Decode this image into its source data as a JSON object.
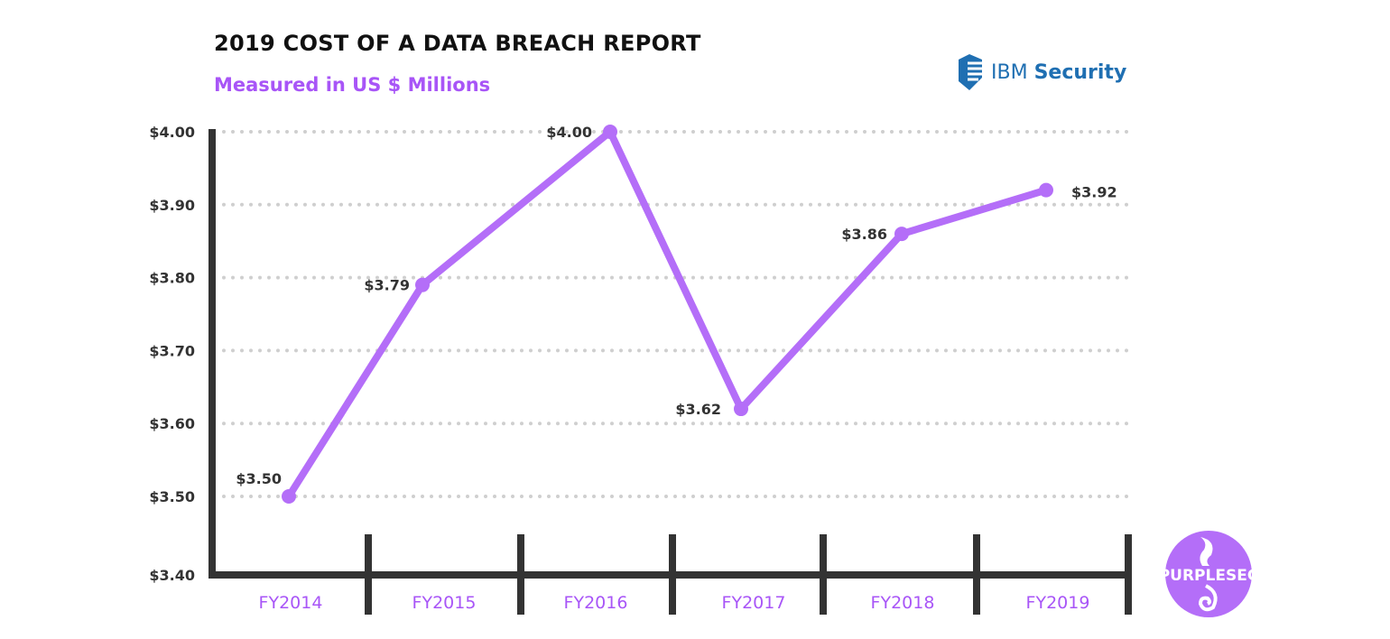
{
  "header": {
    "title": "2019 COST OF A DATA BREACH REPORT",
    "subtitle": "Measured in US $ Millions"
  },
  "logos": {
    "ibm": {
      "prefix": "IBM",
      "name": "Security",
      "color": "#1f6fb2"
    },
    "purplesec": {
      "text": "PURPLESEC",
      "color": "#b46ef8"
    }
  },
  "chart_data": {
    "type": "line",
    "title": "2019 COST OF A DATA BREACH REPORT",
    "subtitle": "Measured in US $ Millions",
    "categories": [
      "FY2014",
      "FY2015",
      "FY2016",
      "FY2017",
      "FY2018",
      "FY2019"
    ],
    "values": [
      3.5,
      3.79,
      4.0,
      3.62,
      3.86,
      3.92
    ],
    "data_labels": [
      "$3.50",
      "$3.79",
      "$4.00",
      "$3.62",
      "$3.86",
      "$3.92"
    ],
    "y_ticks": [
      3.4,
      3.5,
      3.6,
      3.7,
      3.8,
      3.9,
      4.0
    ],
    "y_tick_labels": [
      "$3.40",
      "$3.50",
      "$3.60",
      "$3.70",
      "$3.80",
      "$3.90",
      "$4.00"
    ],
    "ylim": [
      3.4,
      4.0
    ],
    "grid": "dotted horizontal",
    "line_color": "#b46ef8",
    "label_color": "#a855f7",
    "axis_color": "#333333"
  }
}
